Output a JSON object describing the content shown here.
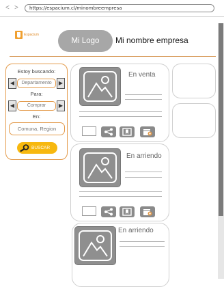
{
  "browser": {
    "url": "https://espacium.cl/minombreempresa",
    "back_icon": "back-arrow-icon",
    "forward_icon": "forward-arrow-icon"
  },
  "header": {
    "brand_text": "Espacium",
    "logo_pill_label": "Mi Logo",
    "company_name": "Mi nombre empresa"
  },
  "search": {
    "looking_for_label": "Estoy buscando:",
    "property_type": "Departamento",
    "for_label": "Para:",
    "operation": "Comprar",
    "in_label": "En:",
    "location_placeholder": "Comuna, Region",
    "button_label": "BUSCAR"
  },
  "listings": [
    {
      "status": "En venta"
    },
    {
      "status": "En arriendo"
    },
    {
      "status": "En arriendo"
    }
  ],
  "colors": {
    "accent": "#e39a4a",
    "button": "#f7b80f",
    "logo_pill": "#a7a7a7",
    "icon_fill": "#8a8a8a"
  },
  "icons": [
    "image-placeholder-icon",
    "share-icon",
    "bookmark-icon",
    "calendar-icon",
    "search-icon"
  ]
}
